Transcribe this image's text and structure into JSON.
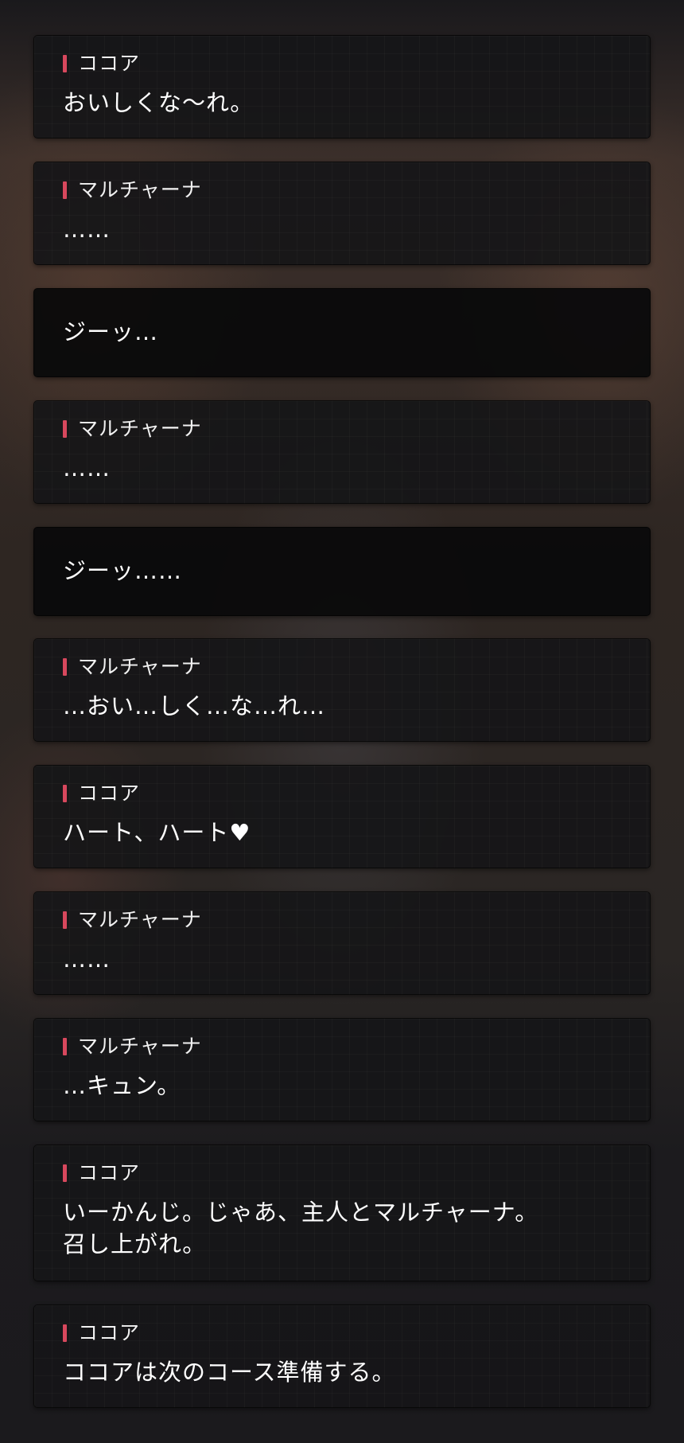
{
  "dialogue": [
    {
      "type": "speech",
      "speaker": "ココア",
      "text": "おいしくな～れ。"
    },
    {
      "type": "speech",
      "speaker": "マルチャーナ",
      "text": "……"
    },
    {
      "type": "narration",
      "text": "ジーッ…"
    },
    {
      "type": "speech",
      "speaker": "マルチャーナ",
      "text": "……"
    },
    {
      "type": "narration",
      "text": "ジーッ……"
    },
    {
      "type": "speech",
      "speaker": "マルチャーナ",
      "text": "…おい…しく…な…れ…"
    },
    {
      "type": "speech",
      "speaker": "ココア",
      "text": "ハート、ハート♥"
    },
    {
      "type": "speech",
      "speaker": "マルチャーナ",
      "text": "……"
    },
    {
      "type": "speech",
      "speaker": "マルチャーナ",
      "text": "…キュン。"
    },
    {
      "type": "speech",
      "speaker": "ココア",
      "text": "いーかんじ。じゃあ、主人とマルチャーナ。\n召し上がれ。"
    },
    {
      "type": "speech",
      "speaker": "ココア",
      "text": "ココアは次のコース準備する。"
    }
  ],
  "colors": {
    "accent": "#d8485d",
    "panel": "#161618",
    "text": "#ffffff"
  }
}
